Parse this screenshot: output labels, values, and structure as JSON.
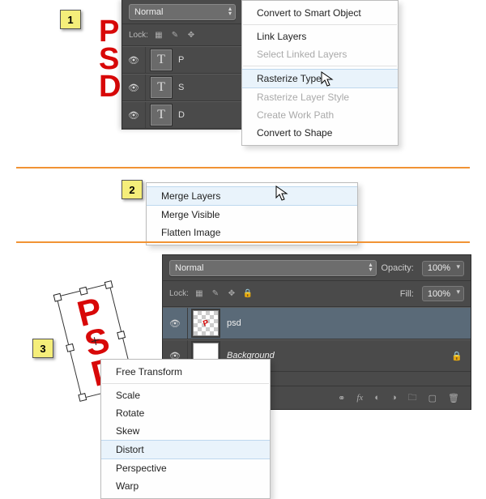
{
  "steps": {
    "one": "1",
    "two": "2",
    "three": "3"
  },
  "psd_letters": [
    "P",
    "S",
    "D"
  ],
  "panel1": {
    "blend_mode": "Normal",
    "lock_label": "Lock:",
    "layers": [
      {
        "thumb": "T",
        "name": "P"
      },
      {
        "thumb": "T",
        "name": "S"
      },
      {
        "thumb": "T",
        "name": "D"
      }
    ]
  },
  "menu1": {
    "items": [
      {
        "label": "Convert to Smart Object",
        "disabled": false,
        "highlight": false
      },
      {
        "sep": true
      },
      {
        "label": "Link Layers",
        "disabled": false,
        "highlight": false
      },
      {
        "label": "Select Linked Layers",
        "disabled": true,
        "highlight": false
      },
      {
        "sep": true
      },
      {
        "label": "Rasterize Type",
        "disabled": false,
        "highlight": true
      },
      {
        "label": "Rasterize Layer Style",
        "disabled": true,
        "highlight": false
      },
      {
        "label": "Create Work Path",
        "disabled": true,
        "highlight": false
      },
      {
        "label": "Convert to Shape",
        "disabled": false,
        "highlight": false
      }
    ]
  },
  "menu2": {
    "items": [
      {
        "label": "Merge Layers",
        "highlight": true
      },
      {
        "label": "Merge Visible",
        "highlight": false
      },
      {
        "label": "Flatten Image",
        "highlight": false
      }
    ]
  },
  "panel3": {
    "blend_mode": "Normal",
    "opacity_label": "Opacity:",
    "opacity_value": "100%",
    "lock_label": "Lock:",
    "fill_label": "Fill:",
    "fill_value": "100%",
    "layers": [
      {
        "name": "psd",
        "selected": true,
        "locked": false,
        "italic": false,
        "checker": true
      },
      {
        "name": "Background",
        "selected": false,
        "locked": true,
        "italic": true,
        "checker": false
      }
    ]
  },
  "menu3": {
    "items": [
      {
        "label": "Free Transform",
        "highlight": false
      },
      {
        "sep": true
      },
      {
        "label": "Scale",
        "highlight": false
      },
      {
        "label": "Rotate",
        "highlight": false
      },
      {
        "label": "Skew",
        "highlight": false
      },
      {
        "label": "Distort",
        "highlight": true
      },
      {
        "label": "Perspective",
        "highlight": false
      },
      {
        "label": "Warp",
        "highlight": false
      }
    ]
  }
}
